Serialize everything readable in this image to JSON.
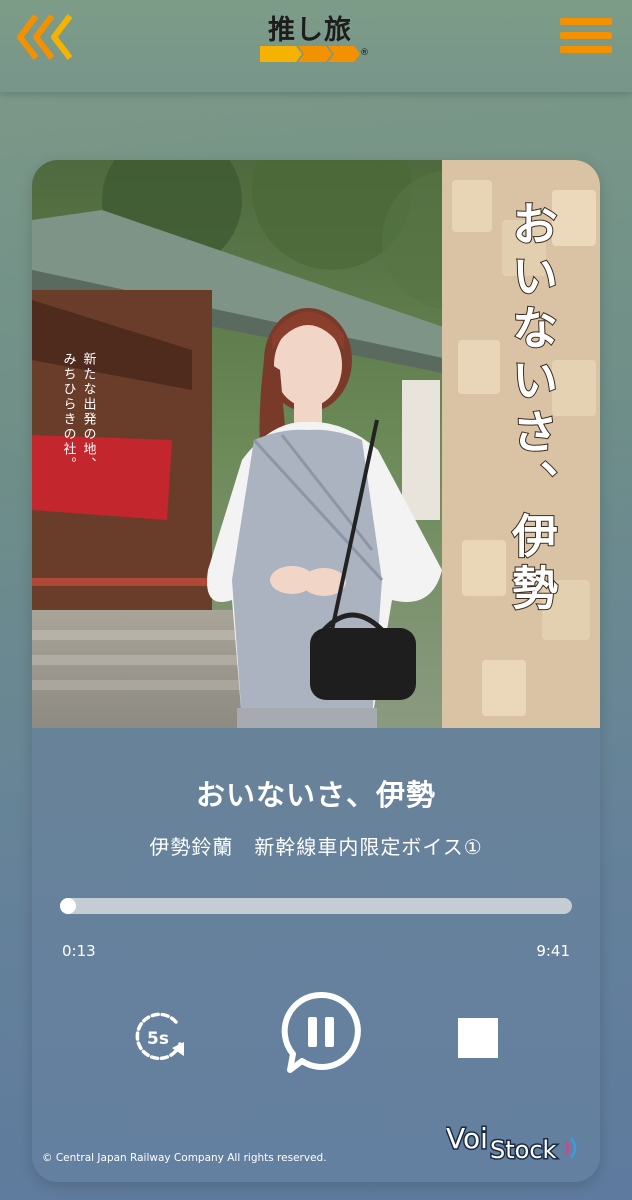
{
  "header": {
    "logo_text": "推し旅",
    "logo_mark": "®",
    "accent_color": "#f39100",
    "back_icon": "chevron-triple-left-icon",
    "menu_icon": "hamburger-menu-icon"
  },
  "cover": {
    "headline": "おいないさ、伊勢",
    "tagline_line1": "新たな出発の地、",
    "tagline_line2": "みちひらきの社。"
  },
  "player": {
    "title": "おいないさ、伊勢",
    "subtitle": "伊勢鈴蘭　新幹線車内限定ボイス①",
    "current_time": "0:13",
    "total_time": "9:41",
    "progress_fraction": 0.022,
    "rewind_label": "5s",
    "rewind_icon": "rewind-5s-icon",
    "pause_icon": "pause-icon",
    "stop_icon": "stop-icon"
  },
  "footer": {
    "copyright": "© Central Japan Railway Company All rights reserved.",
    "brand_voi": "Voi",
    "brand_stock": "Stock"
  }
}
